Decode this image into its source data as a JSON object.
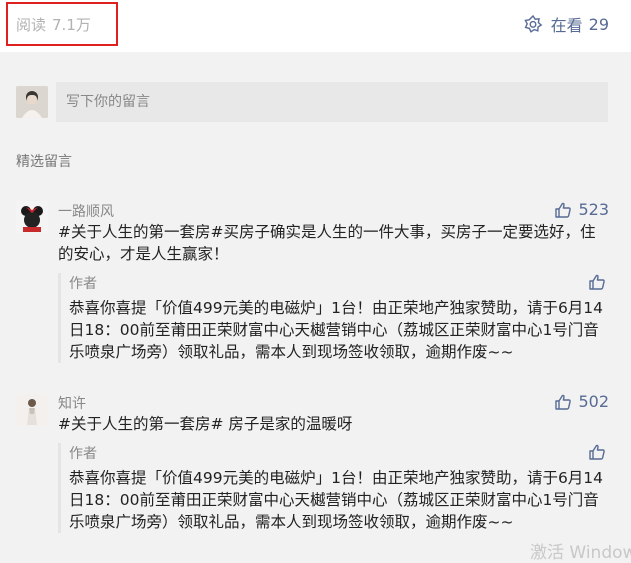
{
  "header": {
    "read_label": "阅读",
    "read_count": "7.1万",
    "watching_label": "在看",
    "watching_count": "29"
  },
  "comment_input": {
    "placeholder": "写下你的留言"
  },
  "section": {
    "title": "精选留言"
  },
  "comments": [
    {
      "name": "一路顺风",
      "likes": "523",
      "text": "#关于人生的第一套房#买房子确实是人生的一件大事，买房子一定要选好，住的安心，才是人生赢家！",
      "reply": {
        "author": "作者",
        "text": "恭喜你喜提「价值499元美的电磁炉」1台！由正荣地产独家赞助，请于6月14日18：00前至莆田正荣财富中心天樾营销中心（荔城区正荣财富中心1号门音乐喷泉广场旁）领取礼品，需本人到现场签收领取，逾期作废~~"
      }
    },
    {
      "name": "知许",
      "likes": "502",
      "text": "#关于人生的第一套房# 房子是家的温暖呀",
      "reply": {
        "author": "作者",
        "text": "恭喜你喜提「价值499元美的电磁炉」1台！由正荣地产独家赞助，请于6月14日18：00前至莆田正荣财富中心天樾营销中心（荔城区正荣财富中心1号门音乐喷泉广场旁）领取礼品，需本人到现场签收领取，逾期作废~~"
      }
    }
  ],
  "watermark": {
    "text": "激活 Windows"
  },
  "colors": {
    "link_blue": "#576b95",
    "highlight_red": "#e02020"
  }
}
